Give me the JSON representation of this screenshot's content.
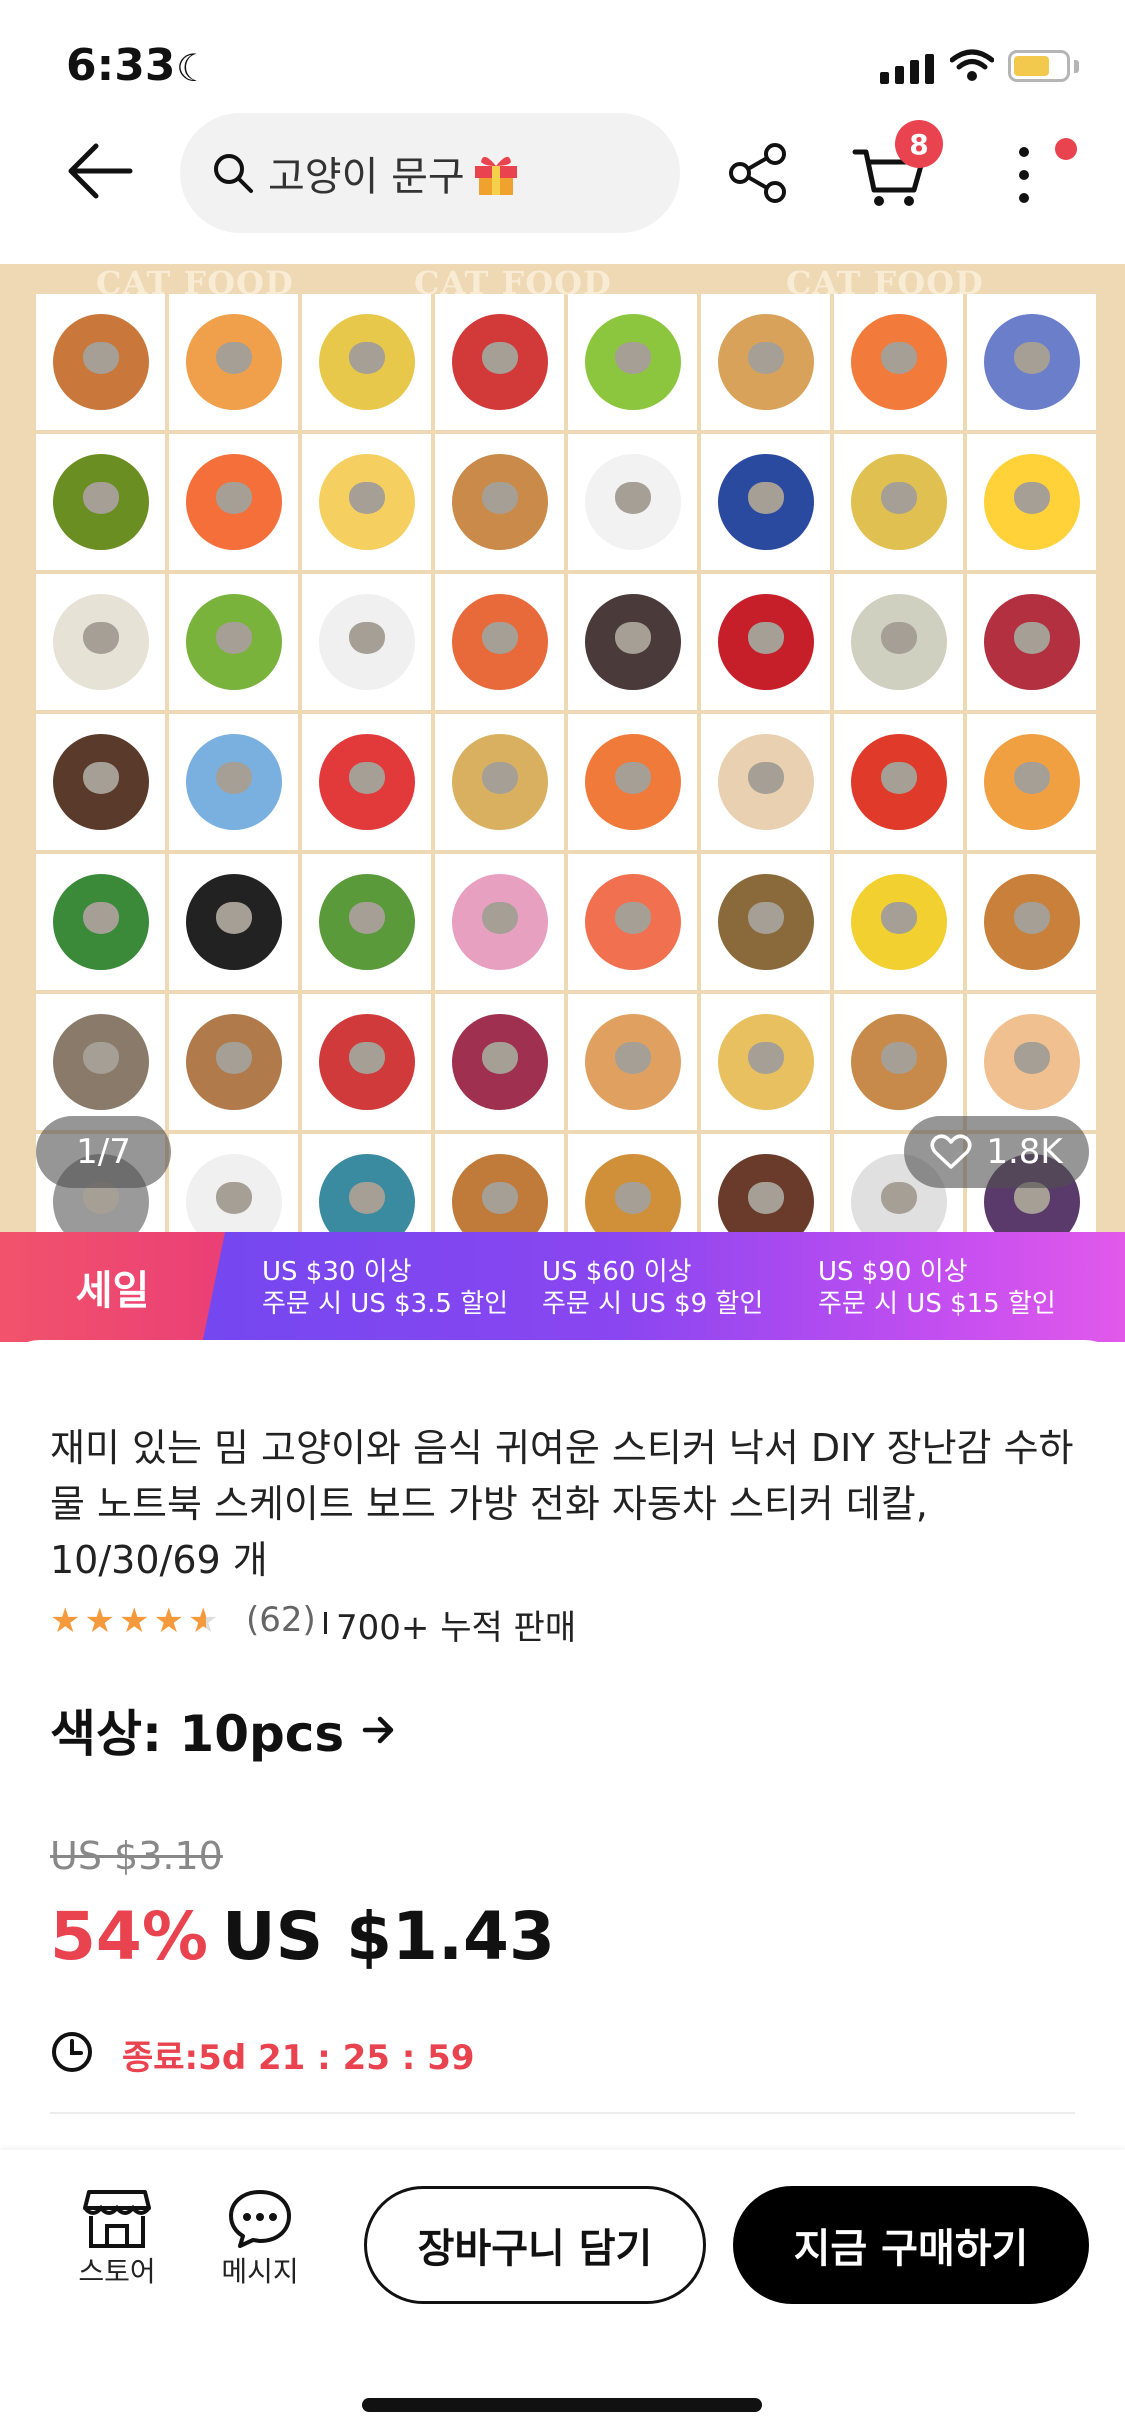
{
  "status_bar": {
    "time": "6:33"
  },
  "header": {
    "search_text": "고양이 문구",
    "cart_count": "8"
  },
  "hero": {
    "watermark_text": "CAT FOOD",
    "page_indicator": "1/7",
    "likes": "1.8K"
  },
  "promo": {
    "sale_label": "세일",
    "tiers": [
      {
        "line1": "US $30 이상",
        "line2": "주문 시 US $3.5 할인"
      },
      {
        "line1": "US $60 이상",
        "line2": "주문 시 US $9 할인"
      },
      {
        "line1": "US $90 이상",
        "line2": "주문 시 US $15 할인"
      }
    ]
  },
  "product": {
    "title": "재미 있는 밈 고양이와 음식 귀여운 스티커 낙서 DIY 장난감 수하물 노트북 스케이트 보드 가방 전화 자동차 스티커 데칼, 10/30/69 개",
    "rating": 4.6,
    "review_count": "(62)",
    "sales": "700+ 누적 판매",
    "color_option": "색상: 10pcs",
    "original_price": "US $3.10",
    "discount": "54%",
    "price": "US $1.43",
    "timer": "종료:5d  21 : 25 : 59"
  },
  "bottom_bar": {
    "store_label": "스토어",
    "message_label": "메시지",
    "add_to_cart": "장바구니 담기",
    "buy_now": "지금 구매하기"
  },
  "colors": {
    "accent": "#e8434e",
    "promo_start": "#6a48f0",
    "promo_end": "#e259ea",
    "hero_bg": "#efd8b4"
  }
}
